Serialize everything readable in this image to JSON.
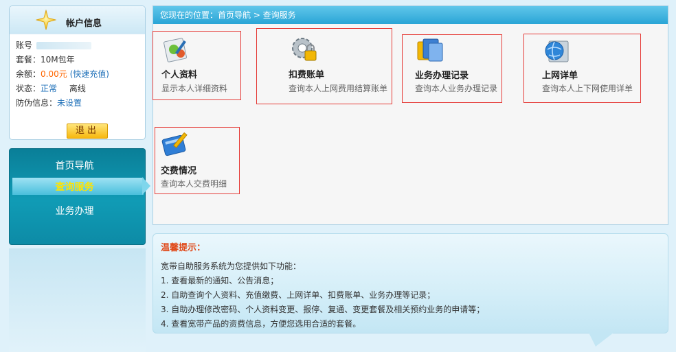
{
  "account": {
    "title": "帐户信息",
    "account_label": "账号",
    "package_label": "套餐：",
    "package_value": "10M包年",
    "balance_label": "余额：",
    "balance_value": "0.00元",
    "recharge_link": "(快速充值)",
    "status_label": "状态：",
    "status_value": "正常",
    "online_status": "离线",
    "security_label": "防伪信息：",
    "security_value": "未设置",
    "logout_label": "退出"
  },
  "nav": {
    "items": [
      "首页导航",
      "查询服务",
      "业务办理"
    ],
    "active_index": 1
  },
  "main": {
    "breadcrumb": "您现在的位置：首页导航 > 查询服务",
    "tiles": [
      {
        "title": "个人资料",
        "desc": "显示本人详细资料",
        "icon": "profile-edit-icon"
      },
      {
        "title": "扣费账单",
        "desc": "查询本人上网费用结算账单",
        "icon": "gear-lock-icon"
      },
      {
        "title": "业务办理记录",
        "desc": "查询本人业务办理记录",
        "icon": "documents-icon"
      },
      {
        "title": "上网详单",
        "desc": "查询本人上下网使用详单",
        "icon": "globe-icon"
      },
      {
        "title": "交费情况",
        "desc": "查询本人交费明细",
        "icon": "book-pen-icon"
      }
    ]
  },
  "tips": {
    "title": "温馨提示：",
    "intro": "宽带自助服务系统为您提供如下功能：",
    "lines": [
      "1. 查看最新的通知、公告消息；",
      "2. 自助查询个人资料、充值缴费、上网详单、扣费账单、业务办理等记录；",
      "3. 自助办理修改密码、个人资料变更、报停、复通、变更套餐及相关预约业务的申请等；",
      "4. 查看宽带产品的资费信息，方便您选用合适的套餐。"
    ]
  },
  "colors": {
    "accent": "#2aa5d6",
    "highlight_border": "#e53935",
    "balance": "#ff6600",
    "nav_active_text": "#ffe400",
    "tips_title": "#e04a1a"
  }
}
